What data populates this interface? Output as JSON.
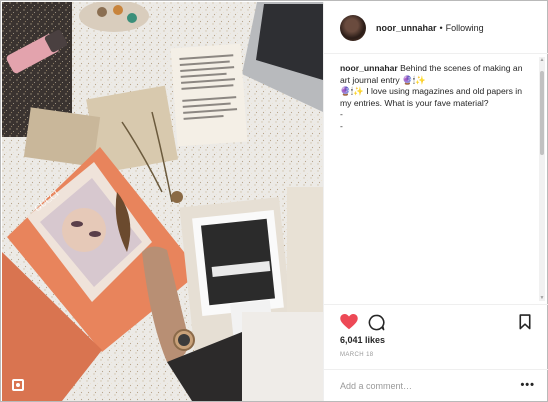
{
  "post": {
    "username": "noor_unnahar",
    "separator": "•",
    "follow_status": "Following"
  },
  "caption": {
    "username": "noor_unnahar",
    "text": "Behind the scenes of making an art journal entry 🔮🕯✨\n🔮🕯✨ I love using magazines and old papers in my entries. What is your fave material?\n-\n-"
  },
  "actions": {
    "like_icon": "heart-filled-icon",
    "comment_icon": "comment-icon",
    "save_icon": "bookmark-icon",
    "like_color": "#ed4956"
  },
  "stats": {
    "likes": "6,041 likes",
    "date": "MARCH 18"
  },
  "comment_box": {
    "placeholder": "Add a comment…",
    "more_label": "•••"
  },
  "photo": {
    "magazine_text": "GUCCI",
    "description_icon": "multiple-media-icon"
  }
}
